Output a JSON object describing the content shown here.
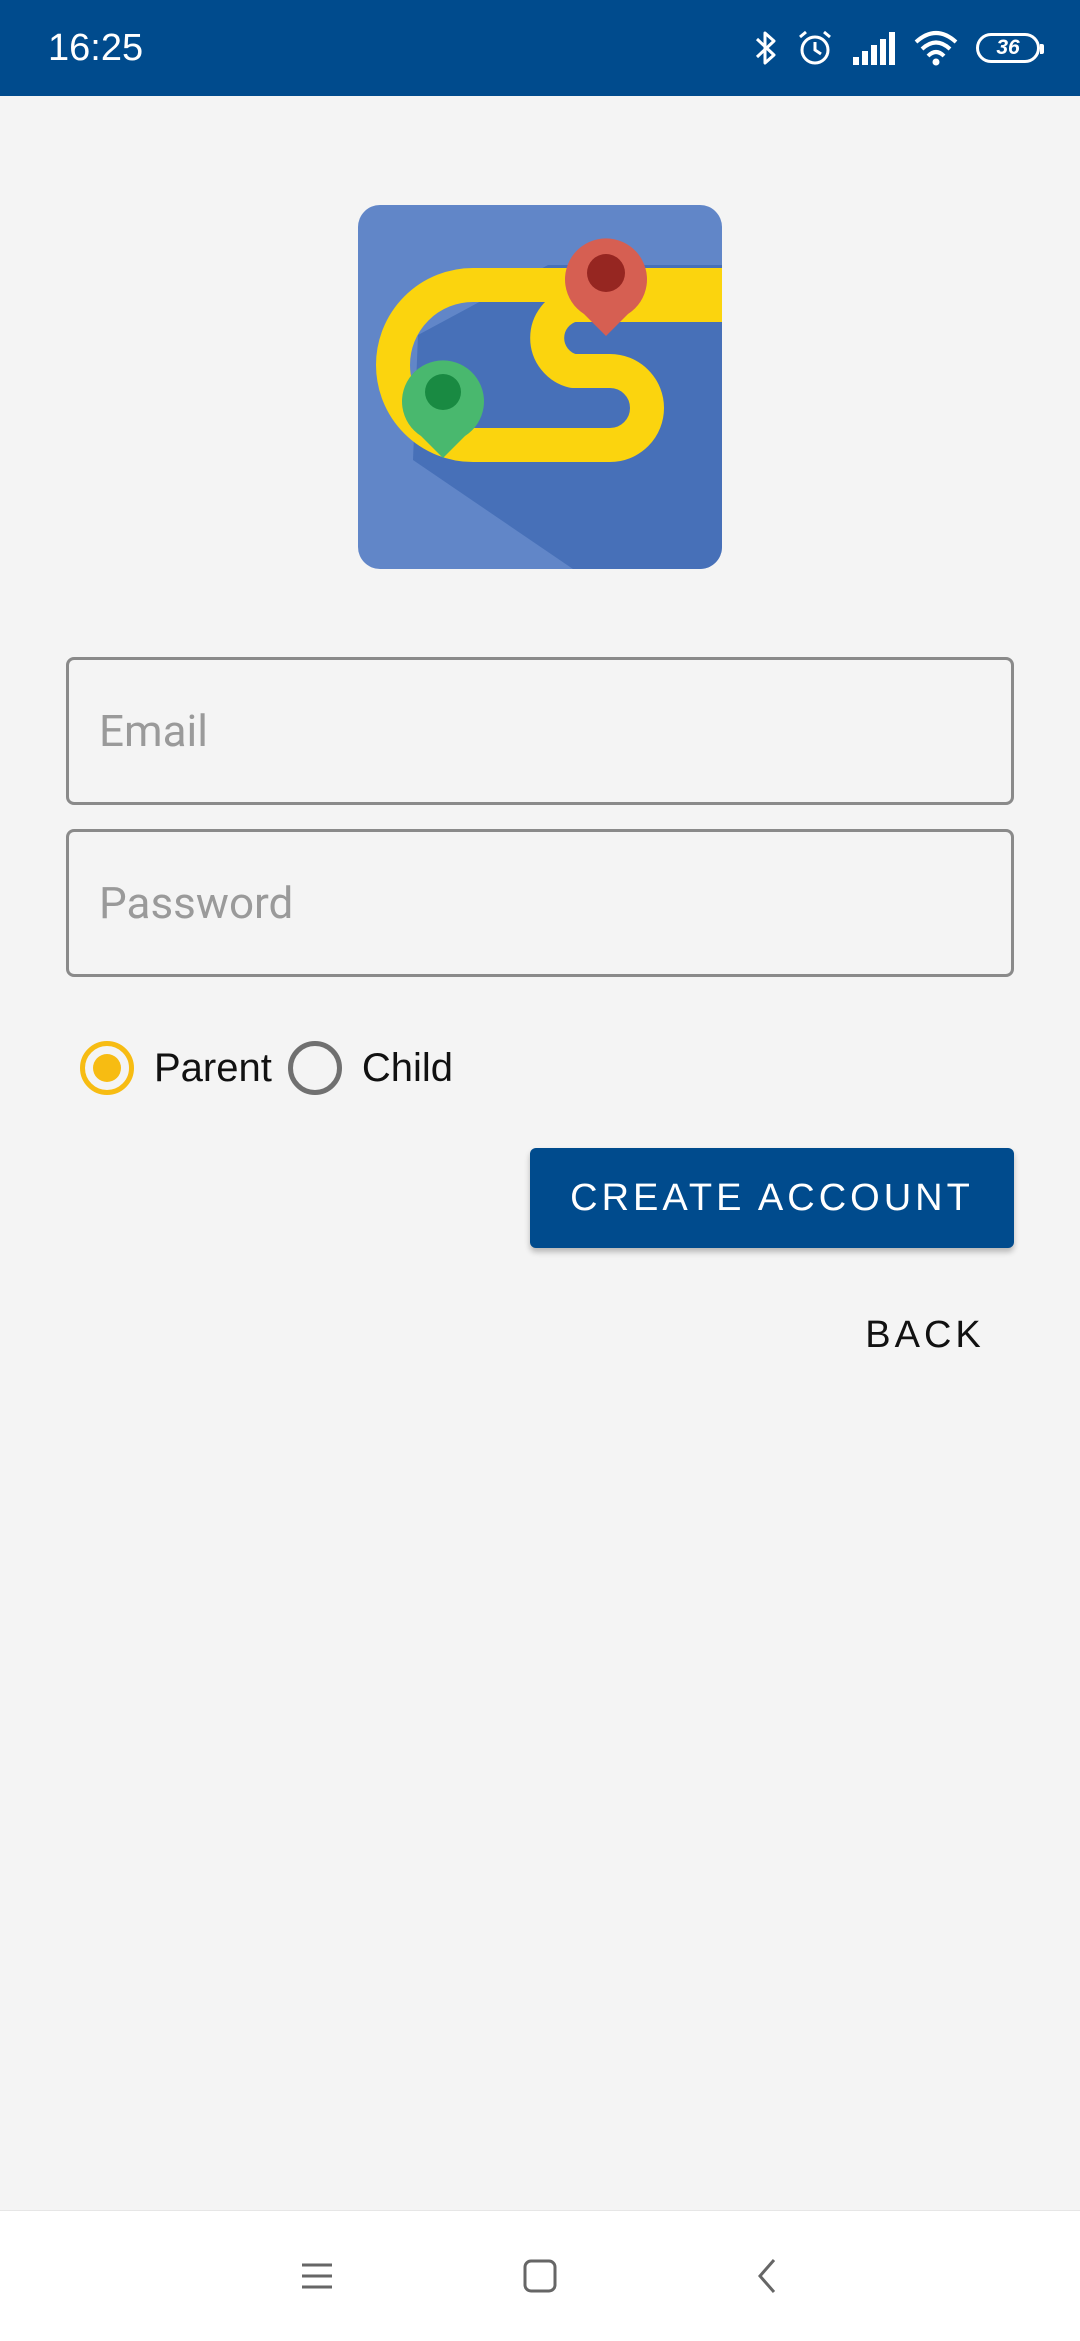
{
  "status_bar": {
    "time": "16:25",
    "battery_level": "36",
    "icons": [
      "bluetooth-icon",
      "alarm-icon",
      "signal-icon",
      "wifi-icon",
      "battery-icon"
    ]
  },
  "logo": {
    "icon": "app-logo",
    "colors": {
      "background": "#6186c8",
      "shadow": "#4770b8",
      "road": "#fbd40e",
      "pin_start": "#49b86e",
      "pin_end": "#d65f52"
    }
  },
  "form": {
    "email_placeholder": "Email",
    "email_value": "",
    "password_placeholder": "Password",
    "password_value": "",
    "role_options": [
      {
        "label": "Parent",
        "selected": true
      },
      {
        "label": "Child",
        "selected": false
      }
    ],
    "create_account_label": "CREATE ACCOUNT",
    "back_label": "BACK"
  },
  "nav_bar": {
    "icons": [
      "menu-icon",
      "home-icon",
      "back-icon"
    ]
  },
  "colors": {
    "primary": "#004b8d",
    "accent": "#f7bc12",
    "background": "#f4f4f4"
  }
}
